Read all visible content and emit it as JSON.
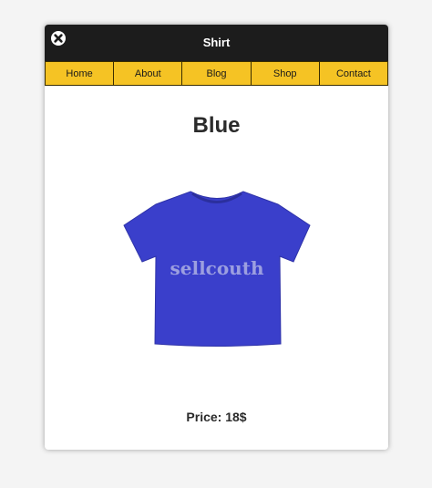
{
  "window": {
    "title": "Shirt"
  },
  "nav": {
    "items": [
      {
        "label": "Home"
      },
      {
        "label": "About"
      },
      {
        "label": "Blog"
      },
      {
        "label": "Shop"
      },
      {
        "label": "Contact"
      }
    ]
  },
  "product": {
    "name": "Blue",
    "image_text": "sellcouth",
    "price_label": "Price: 18$",
    "shirt_color": "#3a3fcb"
  },
  "icons": {
    "close": "close-icon"
  },
  "colors": {
    "titlebar": "#1c1c1c",
    "nav_background": "#f5c324",
    "page_background": "#f4f4f4"
  }
}
